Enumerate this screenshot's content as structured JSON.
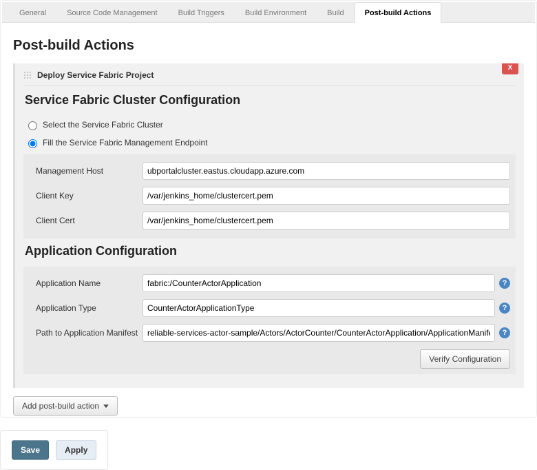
{
  "tabs": [
    "General",
    "Source Code Management",
    "Build Triggers",
    "Build Environment",
    "Build",
    "Post-build Actions"
  ],
  "active_tab": "Post-build Actions",
  "page_title": "Post-build Actions",
  "panel": {
    "title": "Deploy Service Fabric Project",
    "close": "X",
    "cluster_section_title": "Service Fabric Cluster Configuration",
    "radio_select": "Select the Service Fabric Cluster",
    "radio_fill": "Fill the Service Fabric Management Endpoint",
    "mgmt_host_label": "Management Host",
    "mgmt_host_value": "ubportalcluster.eastus.cloudapp.azure.com",
    "client_key_label": "Client Key",
    "client_key_value": "/var/jenkins_home/clustercert.pem",
    "client_cert_label": "Client Cert",
    "client_cert_value": "/var/jenkins_home/clustercert.pem",
    "app_section_title": "Application Configuration",
    "app_name_label": "Application Name",
    "app_name_value": "fabric:/CounterActorApplication",
    "app_type_label": "Application Type",
    "app_type_value": "CounterActorApplicationType",
    "manifest_label": "Path to Application Manifest",
    "manifest_value": "reliable-services-actor-sample/Actors/ActorCounter/CounterActorApplication/ApplicationManifest.xml",
    "verify_button": "Verify Configuration"
  },
  "add_button": "Add post-build action",
  "footer": {
    "save": "Save",
    "apply": "Apply"
  }
}
